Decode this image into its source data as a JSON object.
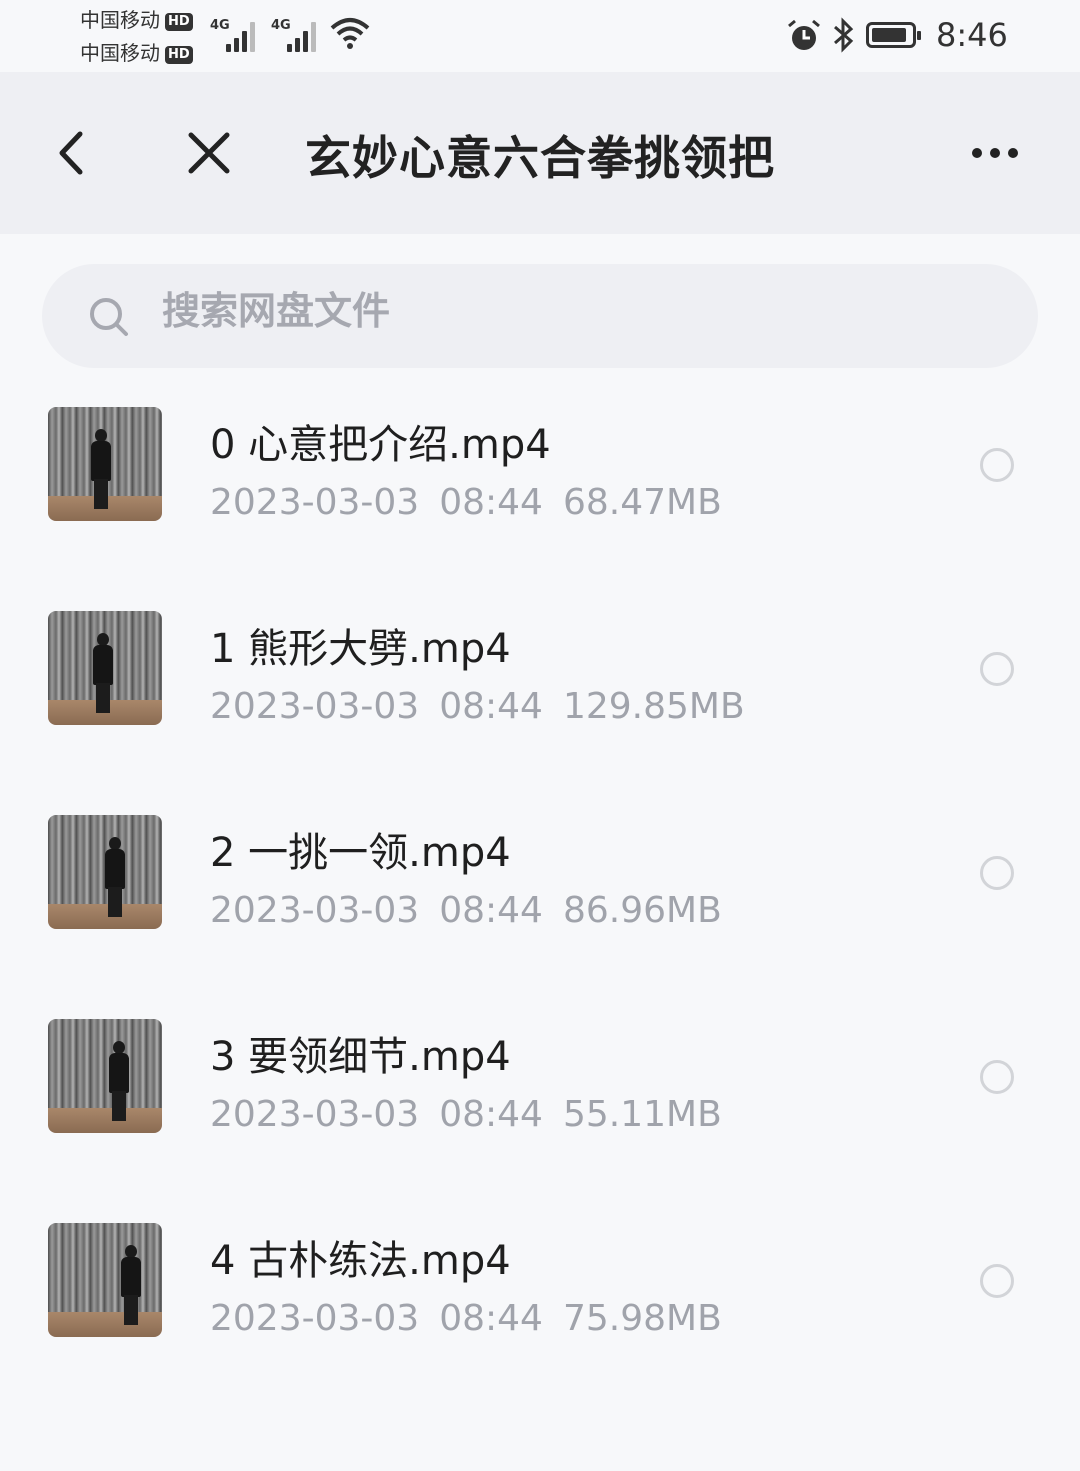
{
  "status_bar": {
    "carrier1": "中国移动",
    "carrier2": "中国移动",
    "hd_badge": "HD",
    "network1": "4G",
    "network2": "4G",
    "time": "8:46",
    "battery_level": 0.9,
    "icons": [
      "signal-icon",
      "wifi-icon",
      "alarm-icon",
      "bluetooth-icon",
      "battery-icon"
    ]
  },
  "header": {
    "title": "玄妙心意六合拳挑领把",
    "icons": [
      "back-icon",
      "close-icon",
      "more-icon"
    ]
  },
  "search": {
    "placeholder": "搜索网盘文件",
    "icon": "search-icon"
  },
  "files": [
    {
      "name": "0 心意把介绍.mp4",
      "date": "2023-03-03",
      "time": "08:44",
      "size": "68.47MB"
    },
    {
      "name": "1 熊形大劈.mp4",
      "date": "2023-03-03",
      "time": "08:44",
      "size": "129.85MB"
    },
    {
      "name": "2 一挑一领.mp4",
      "date": "2023-03-03",
      "time": "08:44",
      "size": "86.96MB"
    },
    {
      "name": "3 要领细节.mp4",
      "date": "2023-03-03",
      "time": "08:44",
      "size": "55.11MB"
    },
    {
      "name": "4 古朴练法.mp4",
      "date": "2023-03-03",
      "time": "08:44",
      "size": "75.98MB"
    }
  ],
  "colors": {
    "background": "#f7f8fa",
    "header_bg": "#eeeff3",
    "text_primary": "#1f1f1f",
    "text_secondary": "#a0a3ab"
  }
}
